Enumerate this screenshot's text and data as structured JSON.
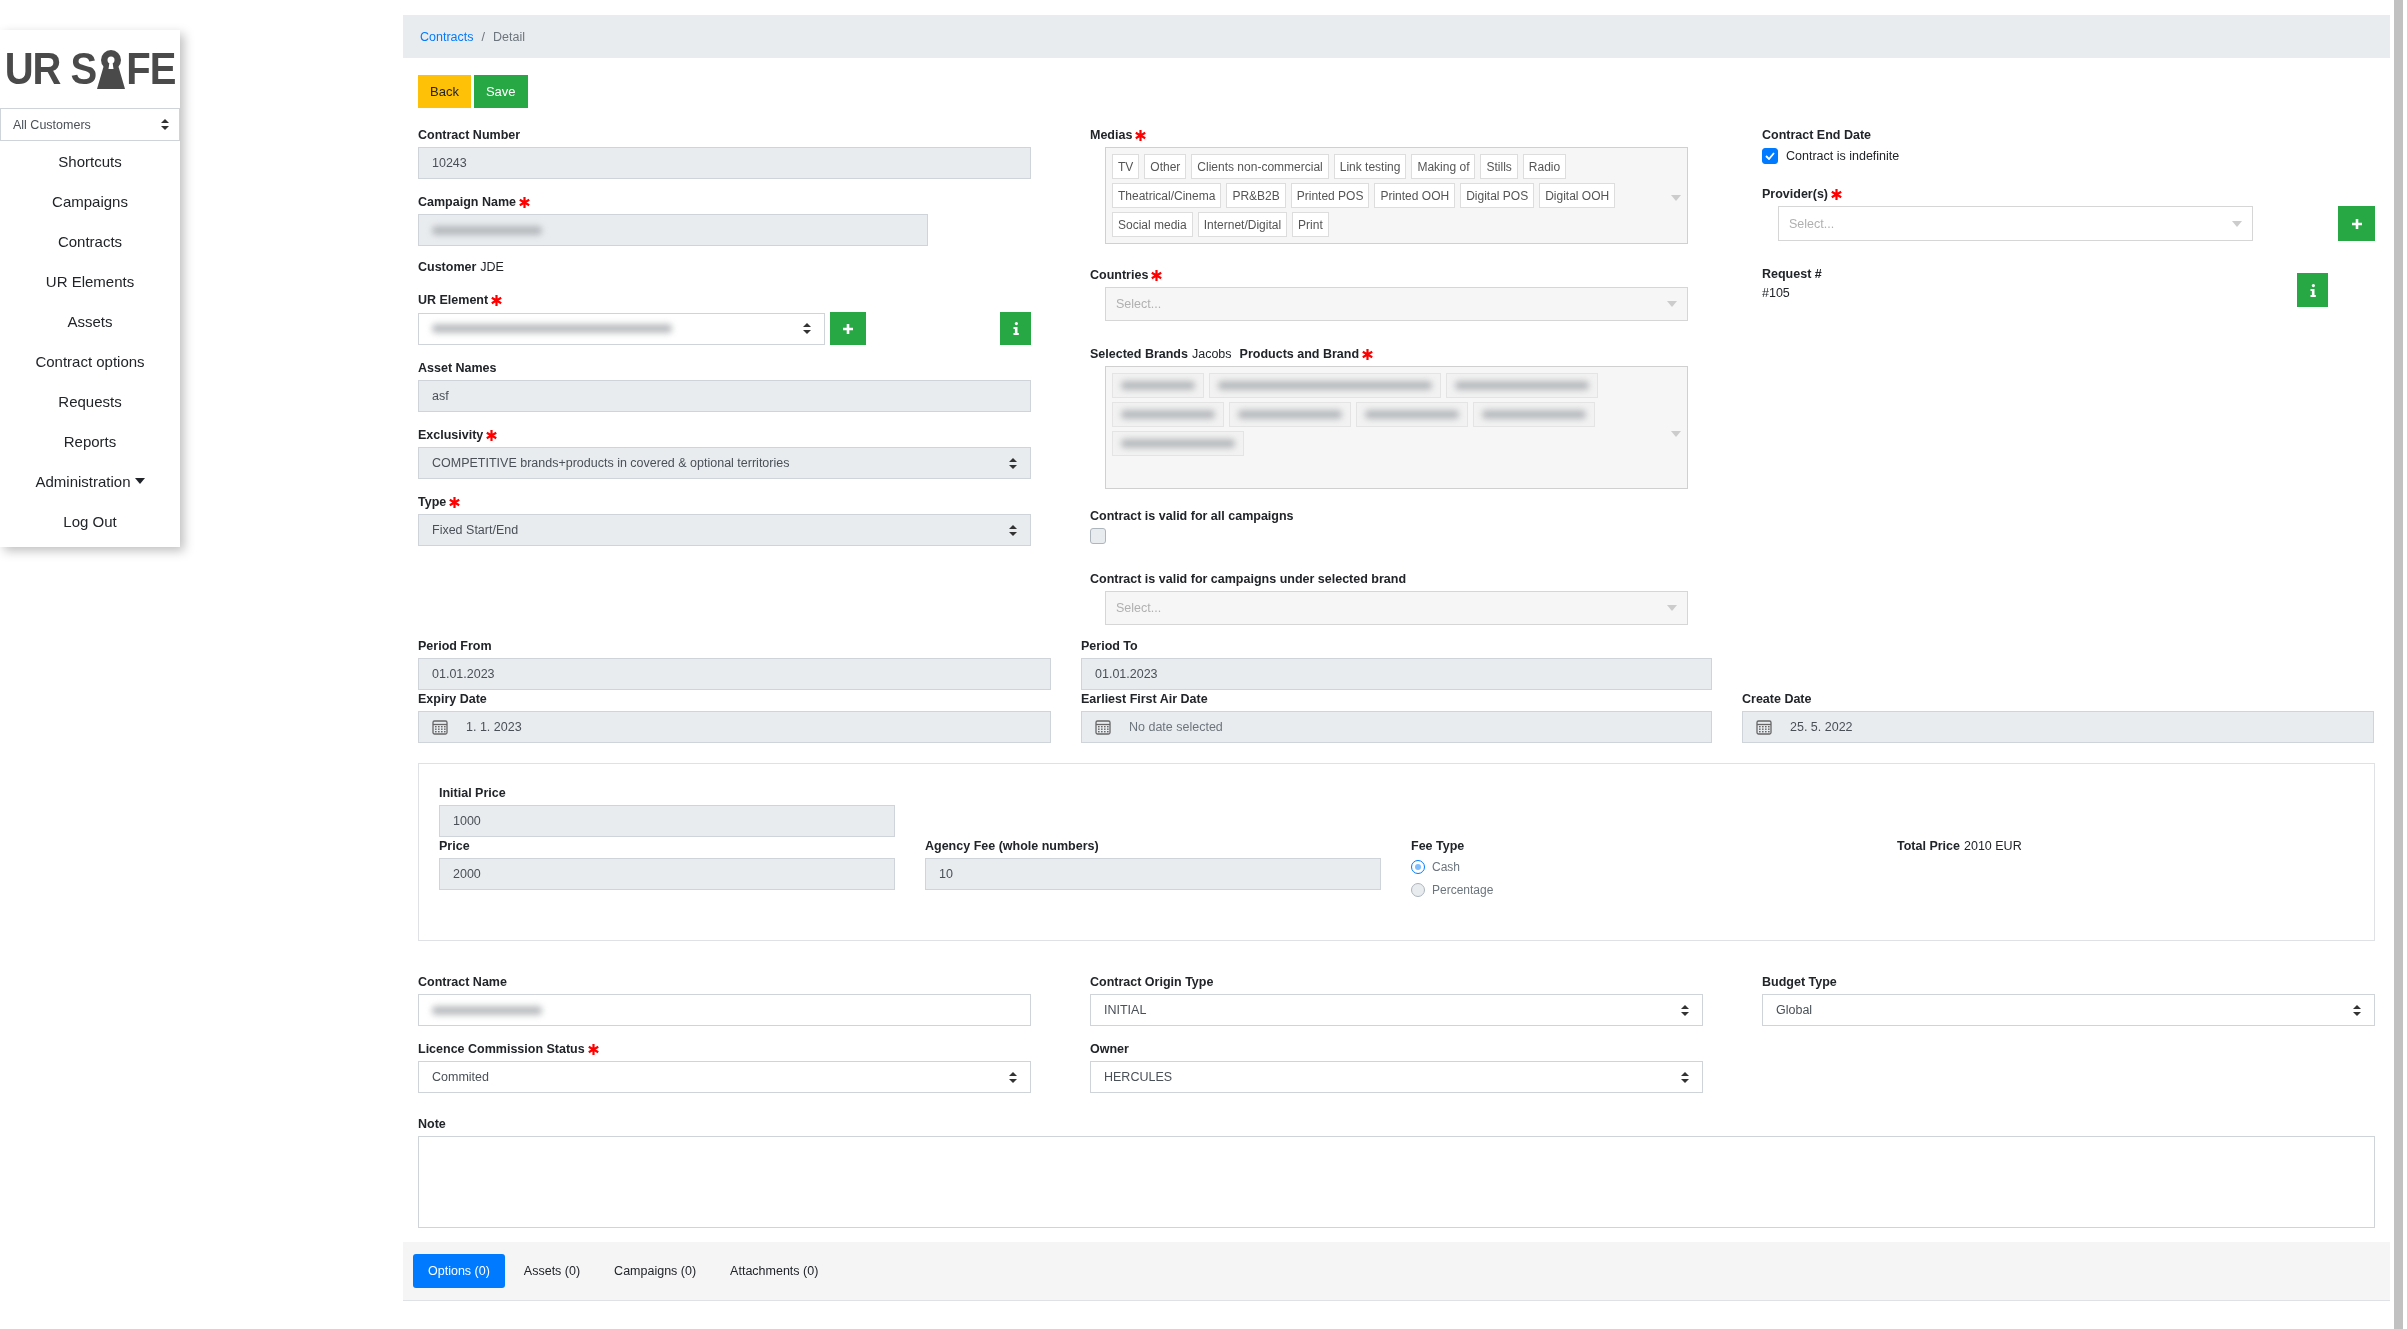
{
  "sidebar": {
    "logo": {
      "before": "UR S",
      "after": "FE"
    },
    "customer_select": "All Customers",
    "nav": [
      {
        "label": "Shortcuts",
        "has_caret": false
      },
      {
        "label": "Campaigns",
        "has_caret": false
      },
      {
        "label": "Contracts",
        "has_caret": false
      },
      {
        "label": "UR Elements",
        "has_caret": false
      },
      {
        "label": "Assets",
        "has_caret": false
      },
      {
        "label": "Contract options",
        "has_caret": false
      },
      {
        "label": "Requests",
        "has_caret": false
      },
      {
        "label": "Reports",
        "has_caret": false
      },
      {
        "label": "Administration",
        "has_caret": true
      },
      {
        "label": "Log Out",
        "has_caret": false
      }
    ]
  },
  "breadcrumb": {
    "separator": "/",
    "items": [
      {
        "label": "Contracts",
        "kind": "link"
      },
      {
        "label": "Detail",
        "kind": "current"
      }
    ]
  },
  "actions": [
    {
      "label": "Back",
      "kind": "warning"
    },
    {
      "label": "Save",
      "kind": "success"
    }
  ],
  "contract_number": {
    "label": "Contract Number",
    "required": false,
    "value": "10243",
    "disabled": true
  },
  "campaign_name": {
    "label": "Campaign Name",
    "required": true,
    "redacted": true,
    "disabled": true
  },
  "customer": {
    "label": "Customer",
    "value": "JDE"
  },
  "ur_element": {
    "label": "UR Element",
    "required": true,
    "redacted": true
  },
  "asset_names": {
    "label": "Asset Names",
    "required": false,
    "value": "asf",
    "disabled": true
  },
  "exclusivity": {
    "label": "Exclusivity",
    "required": true,
    "value": "COMPETITIVE brands+products in covered & optional territories",
    "disabled": true
  },
  "type": {
    "label": "Type",
    "required": true,
    "value": "Fixed Start/End",
    "disabled": true
  },
  "medias": {
    "label": "Medias",
    "required": true,
    "tags": [
      "TV",
      "Other",
      "Clients non-commercial",
      "Link testing",
      "Making of",
      "Stills",
      "Radio",
      "Theatrical/Cinema",
      "PR&B2B",
      "Printed POS",
      "Printed OOH",
      "Digital POS",
      "Digital OOH",
      "Social media",
      "Internet/Digital",
      "Print"
    ]
  },
  "countries": {
    "label": "Countries",
    "required": true,
    "placeholder": "Select..."
  },
  "selected_brands": {
    "label": "Selected Brands",
    "value": "Jacobs"
  },
  "products_and_brand": {
    "label": "Products and Brand",
    "required": true,
    "redacted": true
  },
  "valid_all_campaigns": {
    "label": "Contract is valid for all campaigns",
    "checked": false
  },
  "valid_under_brand": {
    "label": "Contract is valid for campaigns under selected brand",
    "placeholder": "Select..."
  },
  "contract_end_date": {
    "label": "Contract End Date",
    "checkbox_label": "Contract is indefinite",
    "checked": true
  },
  "providers": {
    "label": "Provider(s)",
    "required": true,
    "placeholder": "Select..."
  },
  "request": {
    "label": "Request #",
    "value": "#105"
  },
  "period_from": {
    "label": "Period From",
    "value": "01.01.2023"
  },
  "period_to": {
    "label": "Period To",
    "value": "01.01.2023"
  },
  "expiry_date": {
    "label": "Expiry Date",
    "value": "1. 1. 2023"
  },
  "earliest_first_air_date": {
    "label": "Earliest First Air Date",
    "placeholder": "No date selected"
  },
  "create_date": {
    "label": "Create Date",
    "value": "25. 5. 2022"
  },
  "pricing": {
    "initial_price": {
      "label": "Initial Price",
      "value": "1000"
    },
    "price": {
      "label": "Price",
      "value": "2000"
    },
    "agency_fee": {
      "label": "Agency Fee (whole numbers)",
      "value": "10"
    },
    "fee_type": {
      "label": "Fee Type",
      "options": [
        {
          "label": "Cash",
          "selected": true
        },
        {
          "label": "Percentage",
          "selected": false
        }
      ]
    },
    "total_price": {
      "label": "Total Price",
      "value": "2010 EUR"
    }
  },
  "contract_name": {
    "label": "Contract Name",
    "required": false,
    "redacted": true,
    "disabled": false
  },
  "contract_origin_type": {
    "label": "Contract Origin Type",
    "required": false,
    "value": "INITIAL",
    "disabled": false
  },
  "budget_type": {
    "label": "Budget Type",
    "required": false,
    "value": "Global",
    "disabled": false
  },
  "licence_commission_status": {
    "label": "Licence Commission Status",
    "required": true,
    "value": "Commited",
    "disabled": false
  },
  "owner": {
    "label": "Owner",
    "required": false,
    "value": "HERCULES",
    "disabled": false
  },
  "note": {
    "label": "Note"
  },
  "tabs": [
    {
      "label": "Options (0)",
      "selected": true
    },
    {
      "label": "Assets (0)",
      "selected": false
    },
    {
      "label": "Campaigns (0)",
      "selected": false
    },
    {
      "label": "Attachments (0)",
      "selected": false
    }
  ]
}
